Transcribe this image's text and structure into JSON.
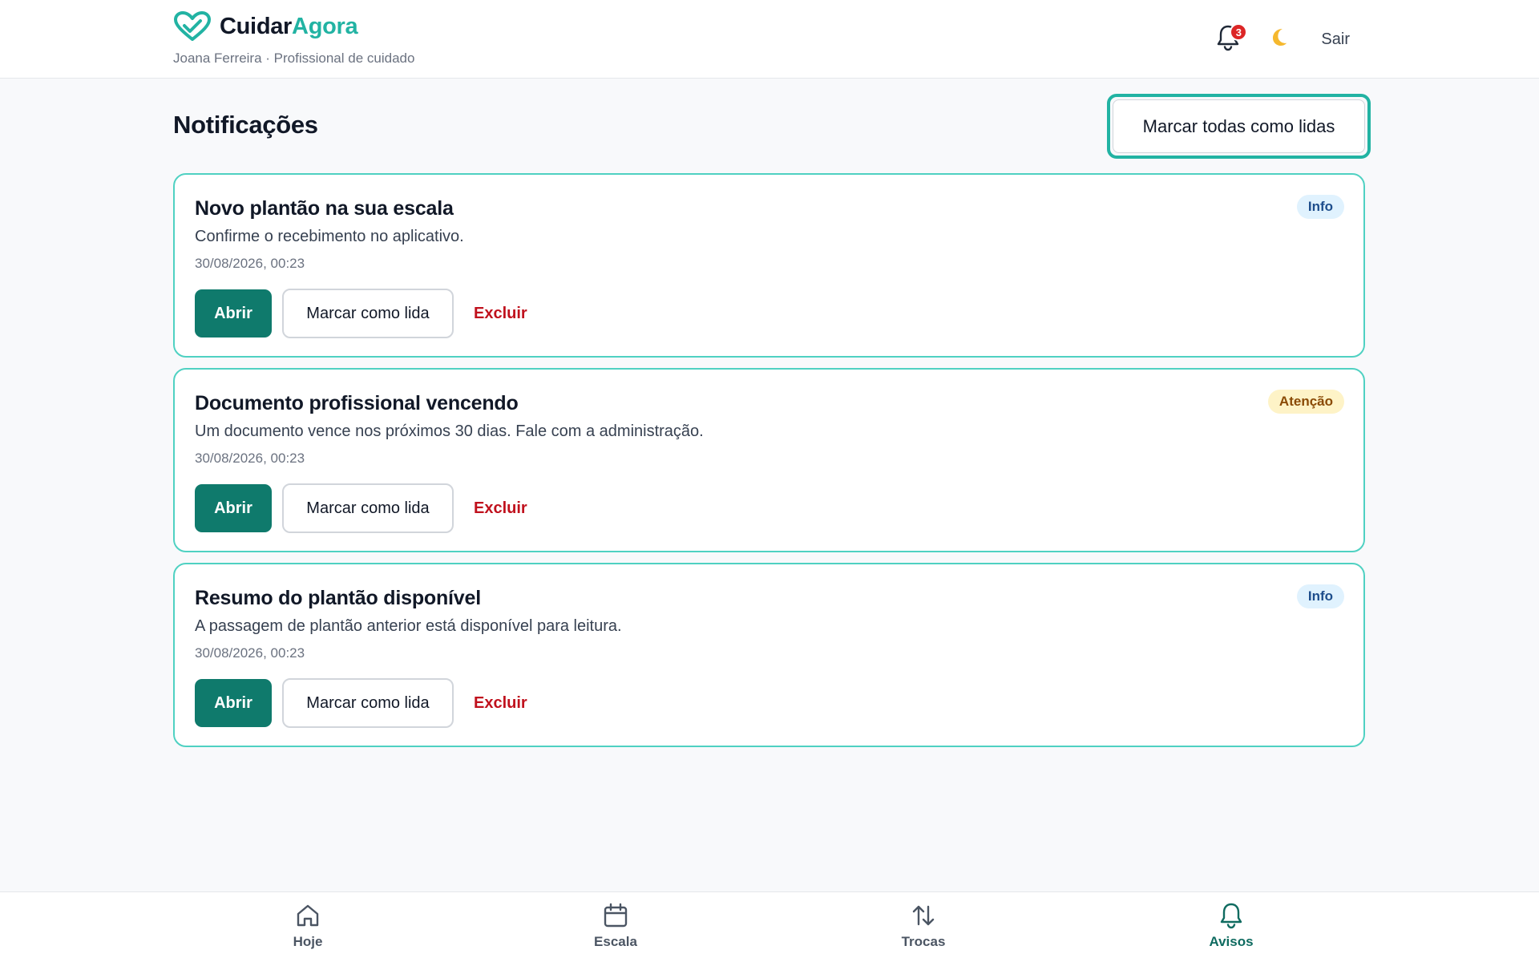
{
  "header": {
    "brand_part1": "Cuidar",
    "brand_part2": "Agora",
    "subtitle": "Joana Ferreira · Profissional de cuidado",
    "notification_count": "3",
    "theme_icon": "moon-icon",
    "logout_label": "Sair"
  },
  "page": {
    "title": "Notificações",
    "mark_all_label": "Marcar todas como lidas"
  },
  "notifications": [
    {
      "title": "Novo plantão na sua escala",
      "description": "Confirme o recebimento no aplicativo.",
      "timestamp": "30/08/2026, 00:23",
      "badge": "Info",
      "badge_type": "info",
      "open_label": "Abrir",
      "mark_read_label": "Marcar como lida",
      "delete_label": "Excluir"
    },
    {
      "title": "Documento profissional vencendo",
      "description": "Um documento vence nos próximos 30 dias. Fale com a administração.",
      "timestamp": "30/08/2026, 00:23",
      "badge": "Atenção",
      "badge_type": "warning",
      "open_label": "Abrir",
      "mark_read_label": "Marcar como lida",
      "delete_label": "Excluir"
    },
    {
      "title": "Resumo do plantão disponível",
      "description": "A passagem de plantão anterior está disponível para leitura.",
      "timestamp": "30/08/2026, 00:23",
      "badge": "Info",
      "badge_type": "info",
      "open_label": "Abrir",
      "mark_read_label": "Marcar como lida",
      "delete_label": "Excluir"
    }
  ],
  "bottom_nav": {
    "items": [
      {
        "label": "Hoje",
        "icon": "home-icon",
        "active": false
      },
      {
        "label": "Escala",
        "icon": "calendar-icon",
        "active": false
      },
      {
        "label": "Trocas",
        "icon": "swap-arrows-icon",
        "active": false
      },
      {
        "label": "Avisos",
        "icon": "bell-icon",
        "active": true
      }
    ]
  },
  "colors": {
    "accent": "#22b3a3",
    "primary_button": "#0f7a6c",
    "danger": "#c0111d",
    "badge_info_bg": "#e0f2fe",
    "badge_warning_bg": "#fef3c7"
  }
}
